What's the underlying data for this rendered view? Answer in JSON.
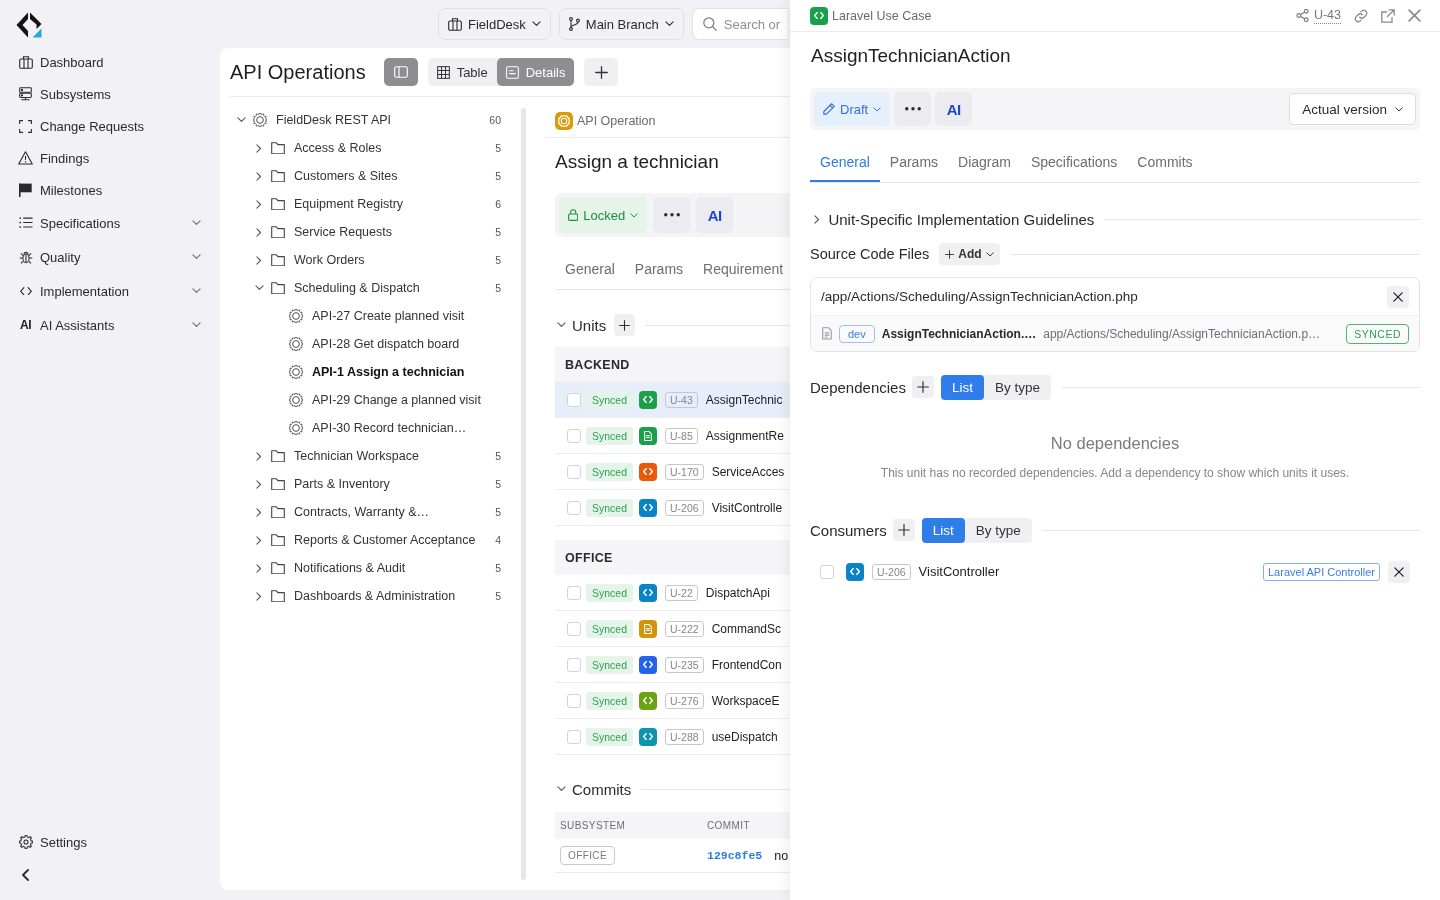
{
  "sidebar": {
    "items": [
      {
        "label": "Dashboard",
        "kind": "link",
        "selected": false
      },
      {
        "label": "Subsystems",
        "kind": "link",
        "selected": false
      },
      {
        "label": "Change Requests",
        "kind": "link",
        "selected": false
      },
      {
        "label": "Findings",
        "kind": "link",
        "selected": false
      },
      {
        "label": "Milestones",
        "kind": "link",
        "selected": false
      },
      {
        "label": "Specifications",
        "kind": "group",
        "expanded": false,
        "selected": false
      },
      {
        "label": "Quality",
        "kind": "group",
        "expanded": false,
        "selected": false
      },
      {
        "label": "Implementation",
        "kind": "group",
        "expanded": false,
        "selected": false
      },
      {
        "label": "AI Assistants",
        "kind": "group",
        "expanded": false,
        "selected": false,
        "icon_text": "AI"
      }
    ],
    "footer_items": [
      {
        "label": "Settings",
        "selected": false
      }
    ]
  },
  "top_bar": {
    "workspace": "FieldDesk",
    "branch": "Main Branch",
    "search": {
      "placeholder": "Search or"
    }
  },
  "tree_panel": {
    "title": "API Operations",
    "panel_toggle": {
      "on": true
    },
    "views": [
      {
        "label": "Table",
        "selected": false
      },
      {
        "label": "Details",
        "selected": true
      }
    ],
    "tree": [
      {
        "kind": "api",
        "label": "FieldDesk REST API",
        "count": "60",
        "expanded": true,
        "selected": false,
        "children": [
          {
            "kind": "folder",
            "label": "Access & Roles",
            "count": "5",
            "expanded": false,
            "selected": false
          },
          {
            "kind": "folder",
            "label": "Customers & Sites",
            "count": "5",
            "expanded": false,
            "selected": false
          },
          {
            "kind": "folder",
            "label": "Equipment Registry",
            "count": "6",
            "expanded": false,
            "selected": false
          },
          {
            "kind": "folder",
            "label": "Service Requests",
            "count": "5",
            "expanded": false,
            "selected": false
          },
          {
            "kind": "folder",
            "label": "Work Orders",
            "count": "5",
            "expanded": false,
            "selected": false
          },
          {
            "kind": "folder",
            "label": "Scheduling & Dispatch",
            "count": "5",
            "expanded": true,
            "selected": false,
            "children": [
              {
                "kind": "operation",
                "label": "API-27 Create planned visit",
                "selected": false
              },
              {
                "kind": "operation",
                "label": "API-28 Get dispatch board",
                "selected": false
              },
              {
                "kind": "operation",
                "label": "API-1 Assign a technician",
                "selected": true
              },
              {
                "kind": "operation",
                "label": "API-29 Change a planned visit",
                "selected": false
              },
              {
                "kind": "operation",
                "label": "API-30 Record technician…",
                "selected": false
              }
            ]
          },
          {
            "kind": "folder",
            "label": "Technician Workspace",
            "count": "5",
            "expanded": false,
            "selected": false
          },
          {
            "kind": "folder",
            "label": "Parts & Inventory",
            "count": "5",
            "expanded": false,
            "selected": false
          },
          {
            "kind": "folder",
            "label": "Contracts, Warranty &…",
            "count": "5",
            "expanded": false,
            "selected": false
          },
          {
            "kind": "folder",
            "label": "Reports & Customer Acceptance",
            "count": "4",
            "expanded": false,
            "selected": false
          },
          {
            "kind": "folder",
            "label": "Notifications & Audit",
            "count": "5",
            "expanded": false,
            "selected": false
          },
          {
            "kind": "folder",
            "label": "Dashboards & Administration",
            "count": "5",
            "expanded": false,
            "selected": false
          }
        ]
      }
    ]
  },
  "detail": {
    "type_label": "API Operation",
    "title": "Assign a technician",
    "status": {
      "kind": "locked",
      "label": "Locked"
    },
    "ai_label": "AI",
    "tabs": [
      {
        "label": "General",
        "selected": false
      },
      {
        "label": "Params",
        "selected": false
      },
      {
        "label": "Requirement",
        "selected": false
      }
    ],
    "units": {
      "title": "Units",
      "expanded": true,
      "groups": [
        {
          "name": "BACKEND",
          "rows": [
            {
              "checked": false,
              "status": "Synced",
              "kind": "code",
              "color": "#1a9f4b",
              "id": "U-43",
              "name": "AssignTechnic",
              "selected": true
            },
            {
              "checked": false,
              "status": "Synced",
              "kind": "file",
              "color": "#1a9f4b",
              "id": "U-85",
              "name": "AssignmentRe",
              "selected": false
            },
            {
              "checked": false,
              "status": "Synced",
              "kind": "code",
              "color": "#e8590c",
              "id": "U-170",
              "name": "ServiceAcces",
              "selected": false
            },
            {
              "checked": false,
              "status": "Synced",
              "kind": "code",
              "color": "#0a84c6",
              "id": "U-206",
              "name": "VisitControlle",
              "selected": false
            }
          ]
        },
        {
          "name": "OFFICE",
          "rows": [
            {
              "checked": false,
              "status": "Synced",
              "kind": "code",
              "color": "#0a84c6",
              "id": "U-22",
              "name": "DispatchApi",
              "selected": false
            },
            {
              "checked": false,
              "status": "Synced",
              "kind": "file",
              "color": "#d4930d",
              "id": "U-222",
              "name": "CommandSc",
              "selected": false
            },
            {
              "checked": false,
              "status": "Synced",
              "kind": "code",
              "color": "#2563eb",
              "id": "U-235",
              "name": "FrontendCon",
              "selected": false
            },
            {
              "checked": false,
              "status": "Synced",
              "kind": "code",
              "color": "#6aa412",
              "id": "U-276",
              "name": "WorkspaceE",
              "selected": false
            },
            {
              "checked": false,
              "status": "Synced",
              "kind": "code",
              "color": "#0e93ad",
              "id": "U-288",
              "name": "useDispatch",
              "selected": false
            }
          ]
        }
      ]
    },
    "commits": {
      "title": "Commits",
      "expanded": true,
      "columns": [
        "SUBSYSTEM",
        "COMMIT"
      ],
      "rows": [
        {
          "subsystem": "OFFICE",
          "commit": "129c8fe5",
          "message": "no"
        }
      ]
    }
  },
  "drawer": {
    "type_label": "Laravel Use Case",
    "id": "U-43",
    "title": "AssignTechnicianAction",
    "status": {
      "kind": "draft",
      "label": "Draft"
    },
    "ai_label": "AI",
    "version": "Actual version",
    "tabs": [
      {
        "label": "General",
        "selected": true
      },
      {
        "label": "Params",
        "selected": false
      },
      {
        "label": "Diagram",
        "selected": false
      },
      {
        "label": "Specifications",
        "selected": false
      },
      {
        "label": "Commits",
        "selected": false
      }
    ],
    "guidelines": {
      "title": "Unit-Specific Implementation Guidelines",
      "expanded": false
    },
    "source_files": {
      "title": "Source Code Files",
      "add_label": "Add",
      "files": [
        {
          "path": "/app/Actions/Scheduling/AssignTechnicianAction.php",
          "branch": "dev",
          "file_name": "AssignTechnicianAction.…",
          "file_path": "app/Actions/Scheduling/AssignTechnicianAction.p…",
          "sync_status": "SYNCED"
        }
      ]
    },
    "dependencies": {
      "title": "Dependencies",
      "views": [
        {
          "label": "List",
          "selected": true
        },
        {
          "label": "By type",
          "selected": false
        }
      ],
      "empty_title": "No dependencies",
      "empty_text": "This unit has no recorded dependencies. Add a dependency to show which units it uses."
    },
    "consumers": {
      "title": "Consumers",
      "views": [
        {
          "label": "List",
          "selected": true
        },
        {
          "label": "By type",
          "selected": false
        }
      ],
      "rows": [
        {
          "checked": false,
          "kind": "code",
          "color": "#0a84c6",
          "id": "U-206",
          "name": "VisitController",
          "tag": "Laravel API Controller"
        }
      ]
    }
  }
}
